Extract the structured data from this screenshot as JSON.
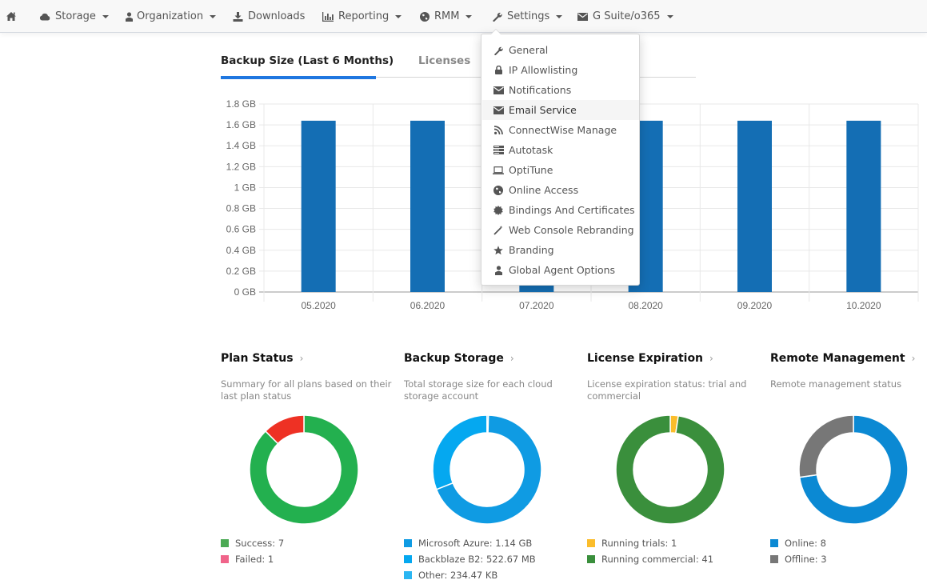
{
  "nav": {
    "items": [
      {
        "id": "home",
        "label": "",
        "icon": "home-icon",
        "caret": false
      },
      {
        "id": "storage",
        "label": "Storage",
        "icon": "cloud-icon",
        "caret": true
      },
      {
        "id": "organization",
        "label": "Organization",
        "icon": "user-icon",
        "caret": true
      },
      {
        "id": "downloads",
        "label": "Downloads",
        "icon": "download-icon",
        "caret": false
      },
      {
        "id": "reporting",
        "label": "Reporting",
        "icon": "bar-chart-icon",
        "caret": true
      },
      {
        "id": "rmm",
        "label": "RMM",
        "icon": "globe-icon",
        "caret": true
      },
      {
        "id": "settings",
        "label": "Settings",
        "icon": "wrench-icon",
        "caret": true
      },
      {
        "id": "gsuite",
        "label": "G Suite/o365",
        "icon": "envelope-icon",
        "caret": true
      }
    ]
  },
  "settings_menu": {
    "items": [
      {
        "label": "General",
        "icon": "wrench-icon"
      },
      {
        "label": "IP Allowlisting",
        "icon": "lock-icon"
      },
      {
        "label": "Notifications",
        "icon": "envelope-icon"
      },
      {
        "label": "Email Service",
        "icon": "envelope-icon",
        "hovered": true
      },
      {
        "label": "ConnectWise Manage",
        "icon": "rss-icon"
      },
      {
        "label": "Autotask",
        "icon": "server-icon"
      },
      {
        "label": "OptiTune",
        "icon": "laptop-icon"
      },
      {
        "label": "Online Access",
        "icon": "globe-icon"
      },
      {
        "label": "Bindings And Certificates",
        "icon": "certificate-icon"
      },
      {
        "label": "Web Console Rebranding",
        "icon": "magic-wand-icon"
      },
      {
        "label": "Branding",
        "icon": "star-icon"
      },
      {
        "label": "Global Agent Options",
        "icon": "user-icon"
      }
    ]
  },
  "tabs": [
    {
      "label": "Backup Size (Last 6 Months)",
      "active": true
    },
    {
      "label": "Licenses",
      "active": false
    }
  ],
  "chart_data": [
    {
      "type": "bar",
      "title": "Backup Size (Last 6 Months)",
      "categories": [
        "05.2020",
        "06.2020",
        "07.2020",
        "08.2020",
        "09.2020",
        "10.2020"
      ],
      "values": [
        1.64,
        1.64,
        1.64,
        1.64,
        1.64,
        1.64
      ],
      "unit": "GB",
      "ylim": [
        0,
        1.8
      ],
      "yticks": [
        "0 GB",
        "0.2 GB",
        "0.4 GB",
        "0.6 GB",
        "0.8 GB",
        "1 GB",
        "1.2 GB",
        "1.4 GB",
        "1.6 GB",
        "1.8 GB"
      ],
      "ytick_values": [
        0,
        0.2,
        0.4,
        0.6,
        0.8,
        1.0,
        1.2,
        1.4,
        1.6,
        1.8
      ],
      "grid": true,
      "bar_color": "#146eb4",
      "xlabel": "",
      "ylabel": ""
    },
    {
      "type": "pie",
      "title": "Plan Status",
      "labels": [
        "Success",
        "Failed"
      ],
      "values": [
        7,
        1
      ],
      "colors": [
        "#23b04f",
        "#ee3124"
      ],
      "legend_colors": [
        "#4caa55",
        "#f0648a"
      ]
    },
    {
      "type": "pie",
      "title": "Backup Storage",
      "labels": [
        "Microsoft Azure",
        "Backblaze B2",
        "Other"
      ],
      "values": [
        1.14,
        0.5104,
        0.000224
      ],
      "display_values": [
        "1.14 GB",
        "522.67 MB",
        "234.47 KB"
      ],
      "colors": [
        "#0f9be3",
        "#05a8f0",
        "#2bb6f2"
      ]
    },
    {
      "type": "pie",
      "title": "License Expiration",
      "labels": [
        "Running trials",
        "Running commercial"
      ],
      "values": [
        1,
        41
      ],
      "colors": [
        "#fbbd2b",
        "#3a8f3c"
      ]
    },
    {
      "type": "pie",
      "title": "Remote Management",
      "labels": [
        "Online",
        "Offline"
      ],
      "values": [
        8,
        3
      ],
      "colors": [
        "#0b89d3",
        "#777777"
      ]
    }
  ],
  "cards": [
    {
      "title": "Plan Status",
      "description": "Summary for all plans based on their last plan status",
      "legend": [
        {
          "text": "Success: 7",
          "color": "#4caa55"
        },
        {
          "text": "Failed: 1",
          "color": "#f0648a"
        }
      ]
    },
    {
      "title": "Backup Storage",
      "description": "Total storage size for each cloud storage account",
      "legend": [
        {
          "text": "Microsoft Azure: 1.14 GB",
          "color": "#0f9be3"
        },
        {
          "text": "Backblaze B2: 522.67 MB",
          "color": "#05a8f0"
        },
        {
          "text": "Other: 234.47 KB",
          "color": "#2bb6f2"
        }
      ]
    },
    {
      "title": "License Expiration",
      "description": "License expiration status: trial and commercial",
      "legend": [
        {
          "text": "Running trials: 1",
          "color": "#fbbd2b"
        },
        {
          "text": "Running commercial: 41",
          "color": "#3a8f3c"
        }
      ]
    },
    {
      "title": "Remote Management",
      "description": "Remote management status",
      "legend": [
        {
          "text": "Online: 8",
          "color": "#0b89d3"
        },
        {
          "text": "Offline: 3",
          "color": "#777777"
        }
      ]
    }
  ],
  "ui": {
    "chevron": "›"
  }
}
